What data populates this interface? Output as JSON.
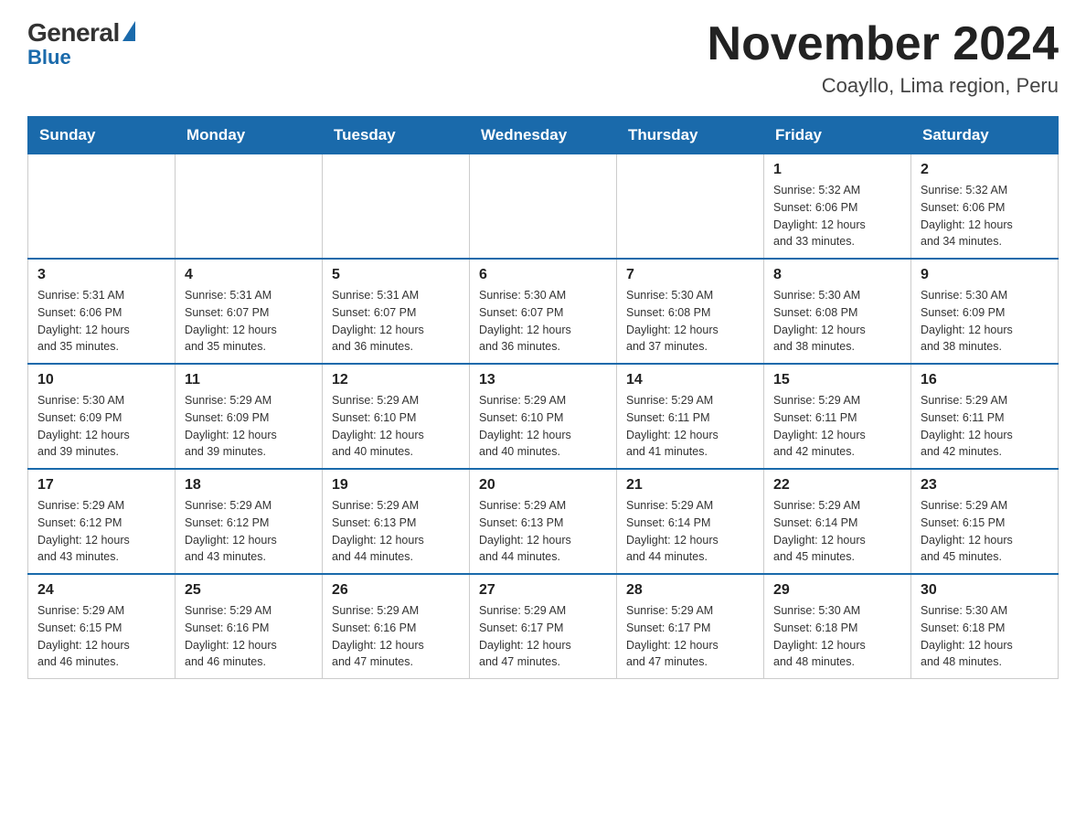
{
  "logo": {
    "general": "General",
    "blue": "Blue"
  },
  "title": "November 2024",
  "location": "Coayllo, Lima region, Peru",
  "weekdays": [
    "Sunday",
    "Monday",
    "Tuesday",
    "Wednesday",
    "Thursday",
    "Friday",
    "Saturday"
  ],
  "weeks": [
    [
      {
        "day": "",
        "info": ""
      },
      {
        "day": "",
        "info": ""
      },
      {
        "day": "",
        "info": ""
      },
      {
        "day": "",
        "info": ""
      },
      {
        "day": "",
        "info": ""
      },
      {
        "day": "1",
        "info": "Sunrise: 5:32 AM\nSunset: 6:06 PM\nDaylight: 12 hours\nand 33 minutes."
      },
      {
        "day": "2",
        "info": "Sunrise: 5:32 AM\nSunset: 6:06 PM\nDaylight: 12 hours\nand 34 minutes."
      }
    ],
    [
      {
        "day": "3",
        "info": "Sunrise: 5:31 AM\nSunset: 6:06 PM\nDaylight: 12 hours\nand 35 minutes."
      },
      {
        "day": "4",
        "info": "Sunrise: 5:31 AM\nSunset: 6:07 PM\nDaylight: 12 hours\nand 35 minutes."
      },
      {
        "day": "5",
        "info": "Sunrise: 5:31 AM\nSunset: 6:07 PM\nDaylight: 12 hours\nand 36 minutes."
      },
      {
        "day": "6",
        "info": "Sunrise: 5:30 AM\nSunset: 6:07 PM\nDaylight: 12 hours\nand 36 minutes."
      },
      {
        "day": "7",
        "info": "Sunrise: 5:30 AM\nSunset: 6:08 PM\nDaylight: 12 hours\nand 37 minutes."
      },
      {
        "day": "8",
        "info": "Sunrise: 5:30 AM\nSunset: 6:08 PM\nDaylight: 12 hours\nand 38 minutes."
      },
      {
        "day": "9",
        "info": "Sunrise: 5:30 AM\nSunset: 6:09 PM\nDaylight: 12 hours\nand 38 minutes."
      }
    ],
    [
      {
        "day": "10",
        "info": "Sunrise: 5:30 AM\nSunset: 6:09 PM\nDaylight: 12 hours\nand 39 minutes."
      },
      {
        "day": "11",
        "info": "Sunrise: 5:29 AM\nSunset: 6:09 PM\nDaylight: 12 hours\nand 39 minutes."
      },
      {
        "day": "12",
        "info": "Sunrise: 5:29 AM\nSunset: 6:10 PM\nDaylight: 12 hours\nand 40 minutes."
      },
      {
        "day": "13",
        "info": "Sunrise: 5:29 AM\nSunset: 6:10 PM\nDaylight: 12 hours\nand 40 minutes."
      },
      {
        "day": "14",
        "info": "Sunrise: 5:29 AM\nSunset: 6:11 PM\nDaylight: 12 hours\nand 41 minutes."
      },
      {
        "day": "15",
        "info": "Sunrise: 5:29 AM\nSunset: 6:11 PM\nDaylight: 12 hours\nand 42 minutes."
      },
      {
        "day": "16",
        "info": "Sunrise: 5:29 AM\nSunset: 6:11 PM\nDaylight: 12 hours\nand 42 minutes."
      }
    ],
    [
      {
        "day": "17",
        "info": "Sunrise: 5:29 AM\nSunset: 6:12 PM\nDaylight: 12 hours\nand 43 minutes."
      },
      {
        "day": "18",
        "info": "Sunrise: 5:29 AM\nSunset: 6:12 PM\nDaylight: 12 hours\nand 43 minutes."
      },
      {
        "day": "19",
        "info": "Sunrise: 5:29 AM\nSunset: 6:13 PM\nDaylight: 12 hours\nand 44 minutes."
      },
      {
        "day": "20",
        "info": "Sunrise: 5:29 AM\nSunset: 6:13 PM\nDaylight: 12 hours\nand 44 minutes."
      },
      {
        "day": "21",
        "info": "Sunrise: 5:29 AM\nSunset: 6:14 PM\nDaylight: 12 hours\nand 44 minutes."
      },
      {
        "day": "22",
        "info": "Sunrise: 5:29 AM\nSunset: 6:14 PM\nDaylight: 12 hours\nand 45 minutes."
      },
      {
        "day": "23",
        "info": "Sunrise: 5:29 AM\nSunset: 6:15 PM\nDaylight: 12 hours\nand 45 minutes."
      }
    ],
    [
      {
        "day": "24",
        "info": "Sunrise: 5:29 AM\nSunset: 6:15 PM\nDaylight: 12 hours\nand 46 minutes."
      },
      {
        "day": "25",
        "info": "Sunrise: 5:29 AM\nSunset: 6:16 PM\nDaylight: 12 hours\nand 46 minutes."
      },
      {
        "day": "26",
        "info": "Sunrise: 5:29 AM\nSunset: 6:16 PM\nDaylight: 12 hours\nand 47 minutes."
      },
      {
        "day": "27",
        "info": "Sunrise: 5:29 AM\nSunset: 6:17 PM\nDaylight: 12 hours\nand 47 minutes."
      },
      {
        "day": "28",
        "info": "Sunrise: 5:29 AM\nSunset: 6:17 PM\nDaylight: 12 hours\nand 47 minutes."
      },
      {
        "day": "29",
        "info": "Sunrise: 5:30 AM\nSunset: 6:18 PM\nDaylight: 12 hours\nand 48 minutes."
      },
      {
        "day": "30",
        "info": "Sunrise: 5:30 AM\nSunset: 6:18 PM\nDaylight: 12 hours\nand 48 minutes."
      }
    ]
  ]
}
